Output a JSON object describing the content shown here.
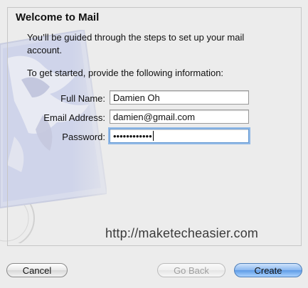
{
  "dialog": {
    "title": "Welcome to Mail",
    "intro": "You’ll be guided through the steps to set up your mail account.",
    "prompt": "To get started, provide the following information:"
  },
  "form": {
    "full_name_label": "Full Name:",
    "full_name_value": "Damien Oh",
    "email_label": "Email Address:",
    "email_value": "damien@gmail.com",
    "password_label": "Password:",
    "password_value": "••••••••••••"
  },
  "watermark": "http://maketecheasier.com",
  "buttons": {
    "cancel": "Cancel",
    "go_back": "Go Back",
    "create": "Create"
  }
}
